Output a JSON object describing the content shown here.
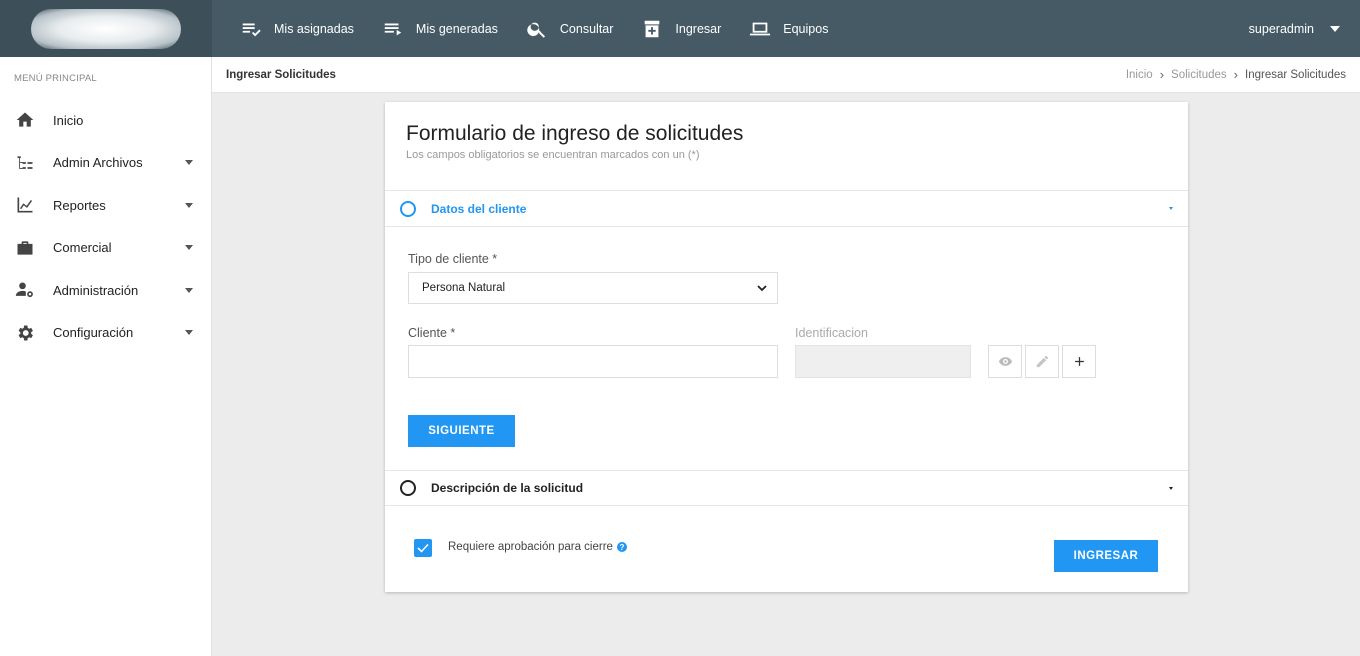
{
  "topbar": {
    "nav": [
      {
        "label": "Mis asignadas",
        "icon": "list-check-icon"
      },
      {
        "label": "Mis generadas",
        "icon": "list-arrow-icon"
      },
      {
        "label": "Consultar",
        "icon": "search-icon"
      },
      {
        "label": "Ingresar",
        "icon": "add-box-icon"
      },
      {
        "label": "Equipos",
        "icon": "laptop-icon"
      }
    ],
    "user": "superadmin"
  },
  "sidebar": {
    "title": "MENÚ PRINCIPAL",
    "items": [
      {
        "label": "Inicio",
        "icon": "home-icon"
      },
      {
        "label": "Admin Archivos",
        "icon": "tree-icon"
      },
      {
        "label": "Reportes",
        "icon": "chart-icon"
      },
      {
        "label": "Comercial",
        "icon": "briefcase-icon"
      },
      {
        "label": "Administración",
        "icon": "user-gear-icon"
      },
      {
        "label": "Configuración",
        "icon": "gear-icon"
      }
    ]
  },
  "breadcrumb": {
    "title": "Ingresar Solicitudes",
    "items": [
      "Inicio",
      "Solicitudes",
      "Ingresar Solicitudes"
    ]
  },
  "form": {
    "title": "Formulario de ingreso de solicitudes",
    "subtitle": "Los campos obligatorios se encuentran marcados con un (*)",
    "step1": {
      "label": "Datos del cliente",
      "tipo_label": "Tipo de cliente *",
      "tipo_value": "Persona Natural",
      "cliente_label": "Cliente *",
      "cliente_value": "",
      "identificacion_label": "Identificacion",
      "identificacion_value": "",
      "next_label": "SIGUIENTE"
    },
    "step2": {
      "label": "Descripción de la solicitud"
    },
    "approval_label": "Requiere aprobación para cierre",
    "approval_checked": true,
    "help_icon": "?",
    "submit_label": "INGRESAR"
  },
  "colors": {
    "topbar": "#455a64",
    "accent": "#2196f3"
  }
}
